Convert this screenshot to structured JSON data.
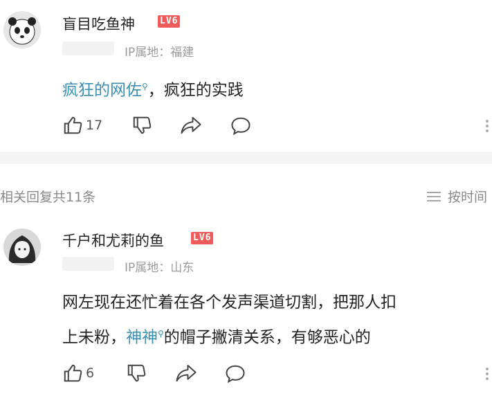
{
  "comments": [
    {
      "username": "盲目吃鱼神",
      "level": "LV6",
      "ip_location": "IP属地：福建",
      "content": {
        "link1": "疯狂的网佐",
        "text1": "，疯狂的实践"
      },
      "likes": "17",
      "avatar_icon": "panda-avatar-icon"
    },
    {
      "username": "千户和尤莉的鱼",
      "level": "LV6",
      "ip_location": "IP属地：山东",
      "content": {
        "line1": "网左现在还忙着在各个发声渠道切割，把那人扣",
        "line2_a": "上未粉，",
        "link1": "神神",
        "line2_b": "的帽子撇清关系，有够恶心的"
      },
      "likes": "6",
      "avatar_icon": "anime-girl-avatar-icon"
    }
  ],
  "replies_header": {
    "label": "相关回复共11条",
    "sort_label": "按时间"
  }
}
